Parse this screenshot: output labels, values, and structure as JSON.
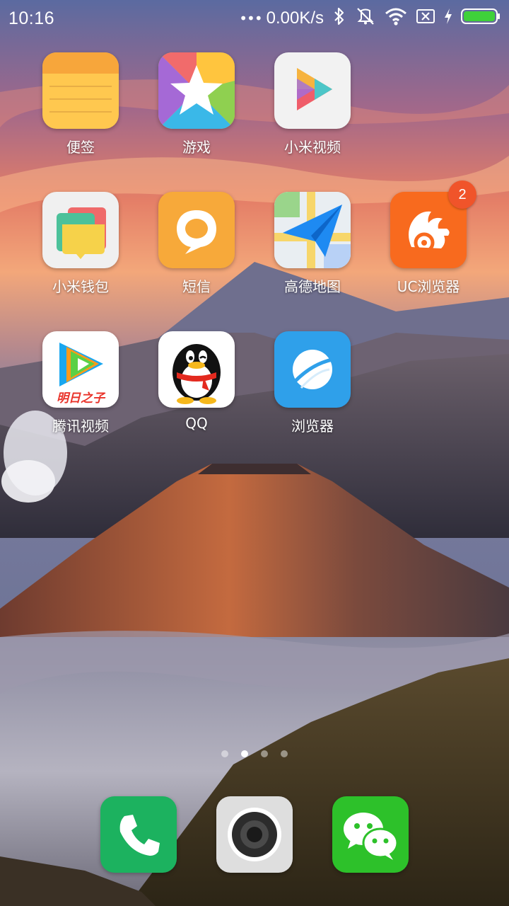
{
  "status_bar": {
    "time": "10:16",
    "more": "•••",
    "network_speed": "0.00K/s",
    "icons": [
      "bluetooth-icon",
      "mute-vibrate-icon",
      "wifi-icon",
      "no-sim-icon",
      "charging-icon",
      "battery-icon"
    ]
  },
  "apps": [
    {
      "label": "便签",
      "icon": "notes-icon"
    },
    {
      "label": "游戏",
      "icon": "games-star-icon"
    },
    {
      "label": "小米视频",
      "icon": "mi-video-icon"
    },
    {
      "label": "小米钱包",
      "icon": "mi-wallet-icon"
    },
    {
      "label": "短信",
      "icon": "messages-icon"
    },
    {
      "label": "高德地图",
      "icon": "amap-icon"
    },
    {
      "label": "UC浏览器",
      "icon": "uc-browser-icon",
      "badge": "2"
    },
    {
      "label": "腾讯视频",
      "icon": "tencent-video-icon",
      "banner": "明日之子"
    },
    {
      "label": "QQ",
      "icon": "qq-penguin-icon"
    },
    {
      "label": "浏览器",
      "icon": "browser-icon"
    }
  ],
  "dock": [
    {
      "icon": "phone-icon"
    },
    {
      "icon": "camera-icon"
    },
    {
      "icon": "wechat-icon"
    }
  ],
  "pager": {
    "pages": 4,
    "active": 2
  }
}
